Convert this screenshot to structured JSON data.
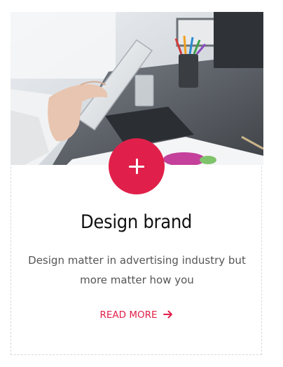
{
  "card": {
    "title": "Design brand",
    "description": "Design matter in advertising industry but more matter how you",
    "read_more_label": "READ MORE",
    "image_alt": "Hand using a tablet on an office desk",
    "icons": {
      "plus": "plus-icon",
      "arrow": "arrow-right-icon"
    },
    "colors": {
      "accent": "#e0204a",
      "title": "#111111",
      "text": "#555555",
      "border": "#d9d9d9"
    }
  }
}
